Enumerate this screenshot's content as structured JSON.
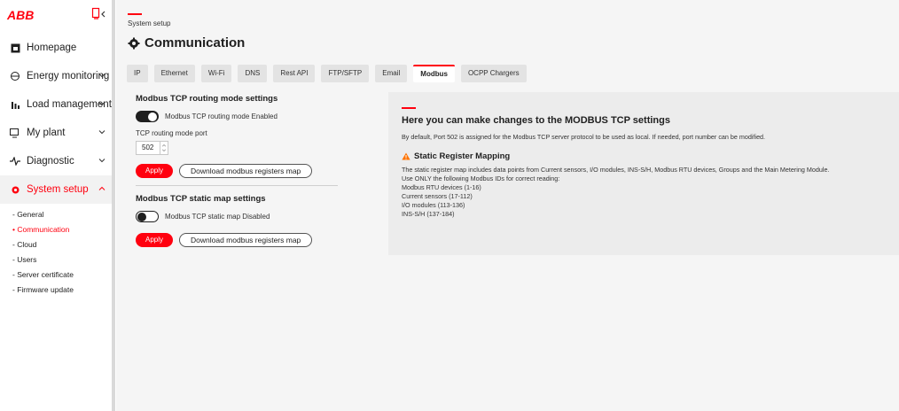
{
  "brand": {
    "logo_text": "ABB",
    "accent_color": "#ff000f"
  },
  "sidebar": {
    "items": [
      {
        "label": "Homepage",
        "icon": "home-icon"
      },
      {
        "label": "Energy monitoring",
        "icon": "energy-monitoring-icon"
      },
      {
        "label": "Load management",
        "icon": "load-management-icon"
      },
      {
        "label": "My plant",
        "icon": "my-plant-icon"
      },
      {
        "label": "Diagnostic",
        "icon": "diagnostic-icon"
      },
      {
        "label": "System setup",
        "icon": "gear-icon"
      }
    ],
    "sub_items": [
      "- General",
      "• Communication",
      "- Cloud",
      "- Users",
      "- Server certificate",
      "- Firmware update"
    ]
  },
  "header": {
    "breadcrumb": "System setup",
    "title": "Communication"
  },
  "tabs": [
    "IP",
    "Ethernet",
    "Wi-Fi",
    "DNS",
    "Rest API",
    "FTP/SFTP",
    "Email",
    "Modbus",
    "OCPP Chargers"
  ],
  "active_tab": "Modbus",
  "routing": {
    "title": "Modbus TCP routing mode settings",
    "toggle_state": "on",
    "toggle_label": "Modbus TCP routing mode Enabled",
    "port_label": "TCP routing mode port",
    "port_value": "502",
    "apply_label": "Apply",
    "download_label": "Download modbus registers map"
  },
  "static_map": {
    "title": "Modbus TCP static map settings",
    "toggle_state": "off",
    "toggle_label": "Modbus TCP static map Disabled",
    "apply_label": "Apply",
    "download_label": "Download modbus registers map"
  },
  "info": {
    "title": "Here you can make changes to the MODBUS TCP settings",
    "description": "By default, Port 502 is assigned for the Modbus TCP server protocol to be used as local. If needed, port number can be modified.",
    "static_title": "Static Register Mapping",
    "lines": [
      "The static register map includes data points from Current sensors, I/O modules, INS-S/H, Modbus RTU devices, Groups and the Main Metering Module.",
      "Use ONLY the following Modbus IDs for correct reading:",
      "Modbus RTU devices (1-16)",
      "Current sensors (17-112)",
      "I/O modules (113-136)",
      "INS-S/H (137-184)"
    ],
    "warning_color": "#ff7300"
  }
}
